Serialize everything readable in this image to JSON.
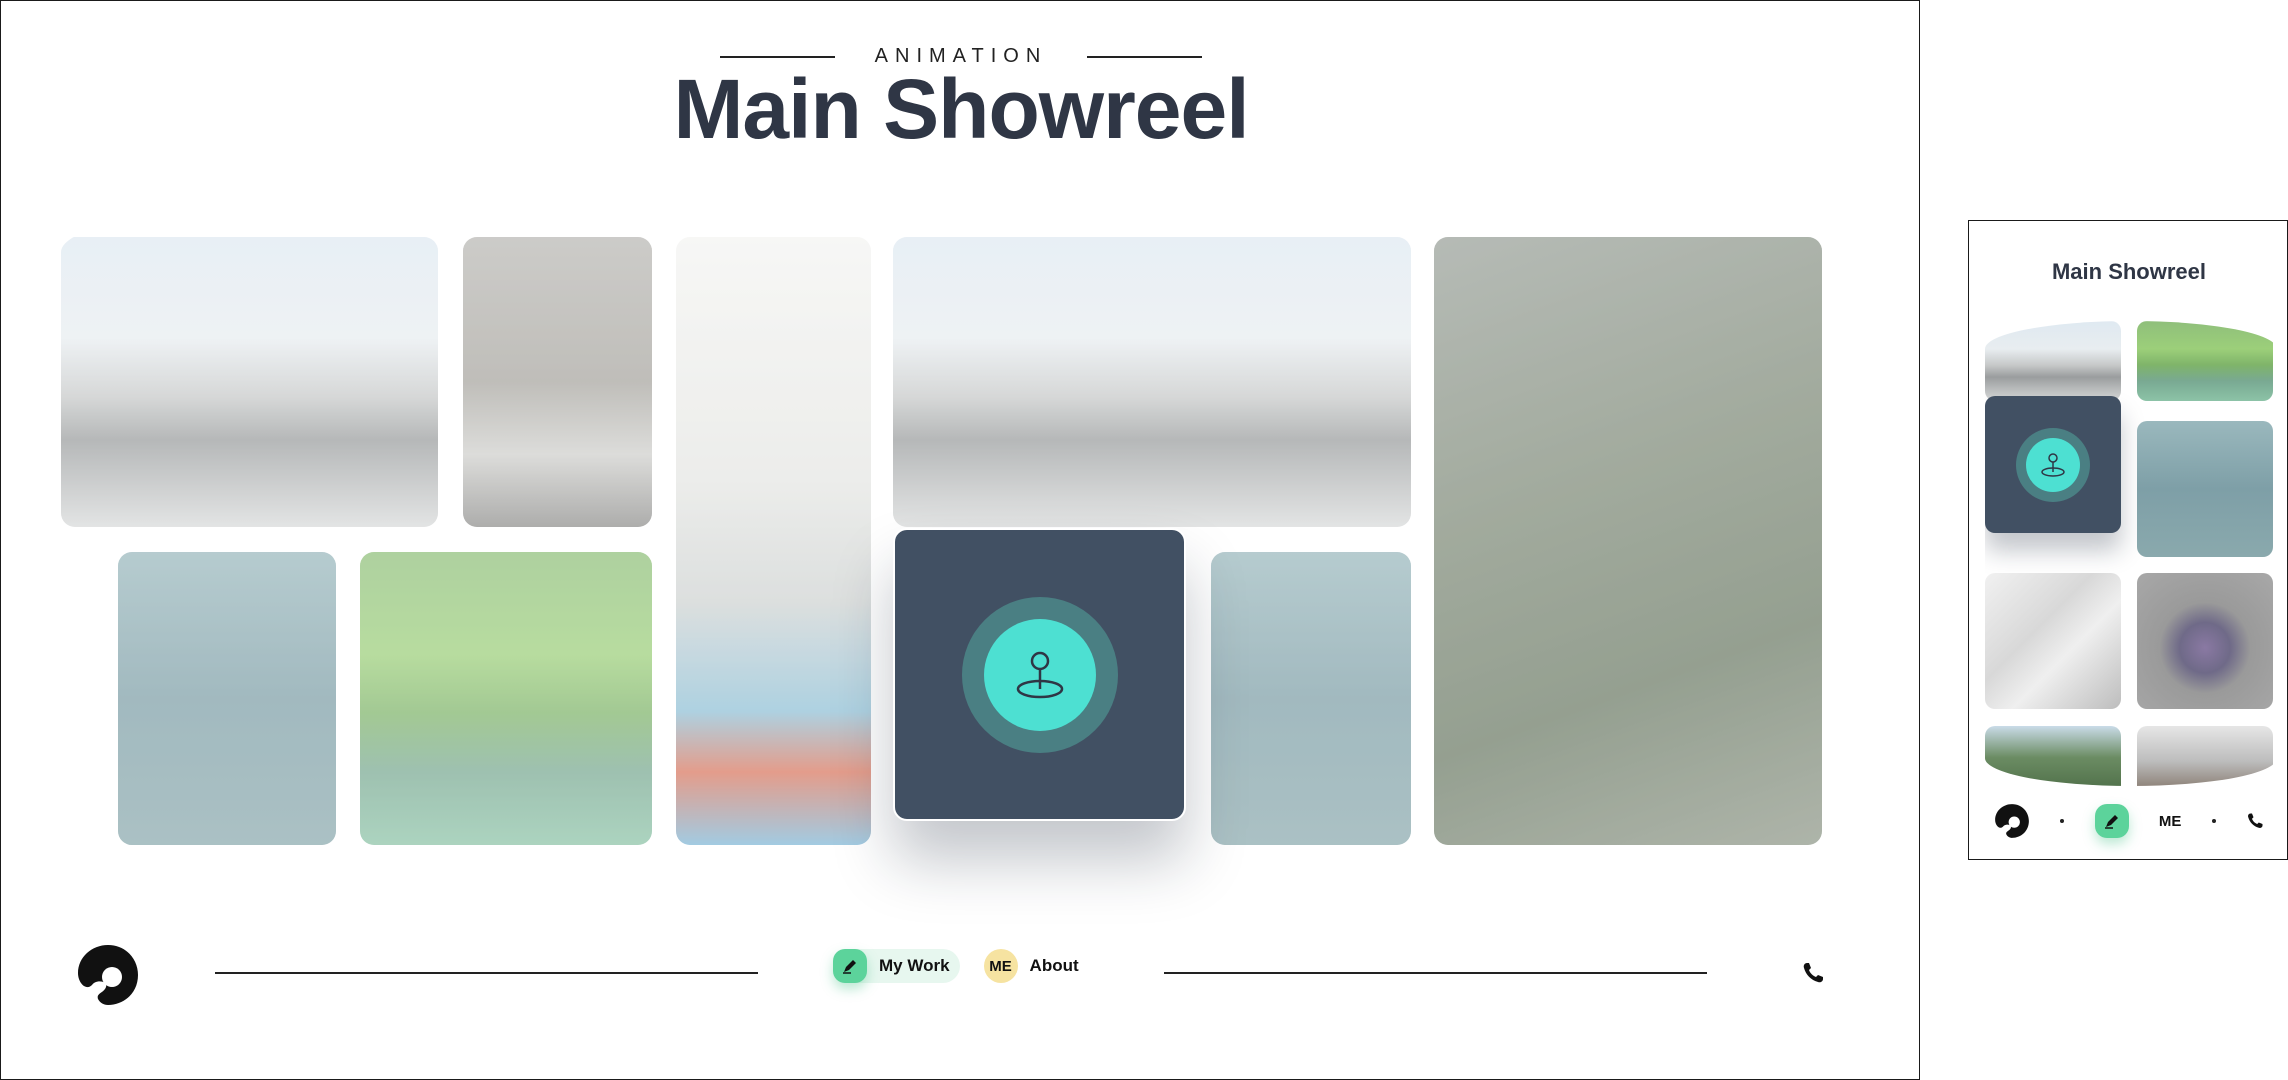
{
  "header": {
    "eyebrow": "ANIMATION",
    "title": "Main Showreel"
  },
  "nav": {
    "items": [
      {
        "label": "My Work",
        "badge_icon": "pen-icon",
        "badge_color": "#5cd39b",
        "active": true
      },
      {
        "label": "About",
        "badge_text": "ME",
        "badge_color": "#f6e3a1",
        "active": false
      }
    ],
    "phone_icon": "phone-icon",
    "logo_icon": "blob-logo-icon"
  },
  "gallery": {
    "featured_icon": "map-pin-icon",
    "accent": "#4de0d2",
    "card_color": "#415063"
  },
  "mobile": {
    "title": "Main Showreel",
    "nav_me": "ME"
  }
}
